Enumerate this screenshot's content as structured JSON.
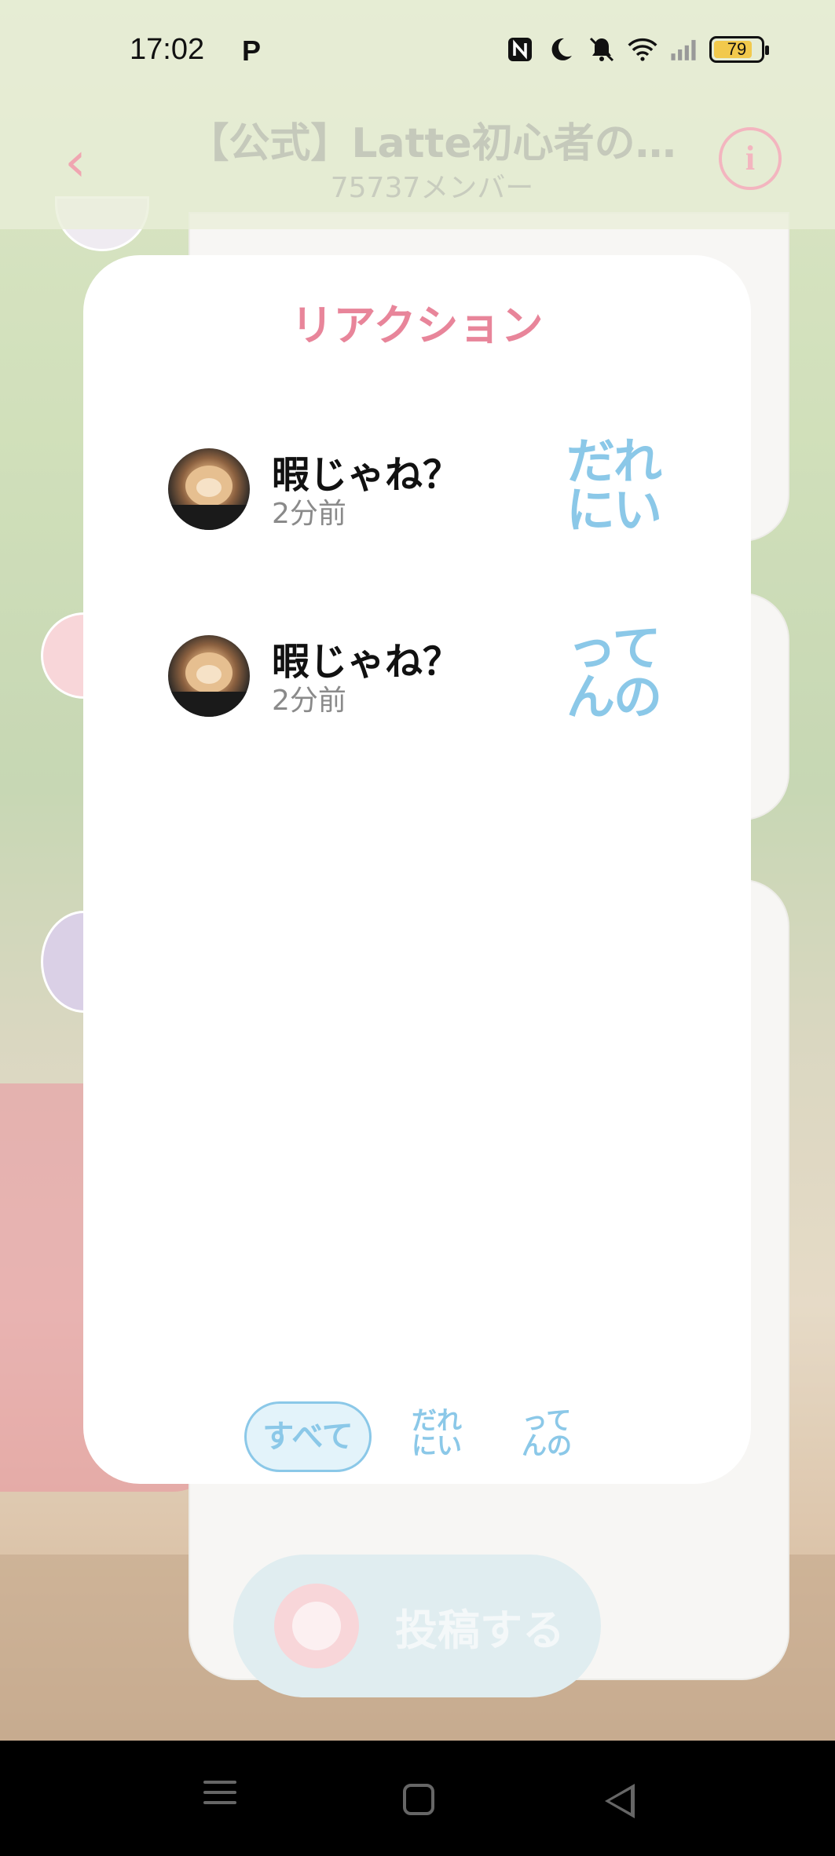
{
  "status_bar": {
    "time": "17:02",
    "app_indicator": "P",
    "icons": [
      "nfc-icon",
      "moon-icon",
      "bell-off-icon",
      "wifi-icon",
      "signal-icon"
    ],
    "battery": "79"
  },
  "header": {
    "title": "【公式】Latte初心者の…",
    "member_count": "75737メンバー",
    "back_symbol": "‹",
    "info_symbol": "i"
  },
  "background": {
    "post_button_label": "投稿する"
  },
  "modal": {
    "title": "リアクション",
    "reactions": [
      {
        "name": "暇じゃね？",
        "time": "2分前",
        "stamp_line1": "だれ",
        "stamp_line2": "にい"
      },
      {
        "name": "暇じゃね？",
        "time": "2分前",
        "stamp_line1": "って",
        "stamp_line2": "んの"
      }
    ],
    "tabs": {
      "all": "すべて",
      "stamp1_line1": "だれ",
      "stamp1_line2": "にい",
      "stamp2_line1": "って",
      "stamp2_line2": "んの"
    }
  },
  "colors": {
    "accent_pink": "#e8859a",
    "accent_blue": "#8bc8e8"
  }
}
